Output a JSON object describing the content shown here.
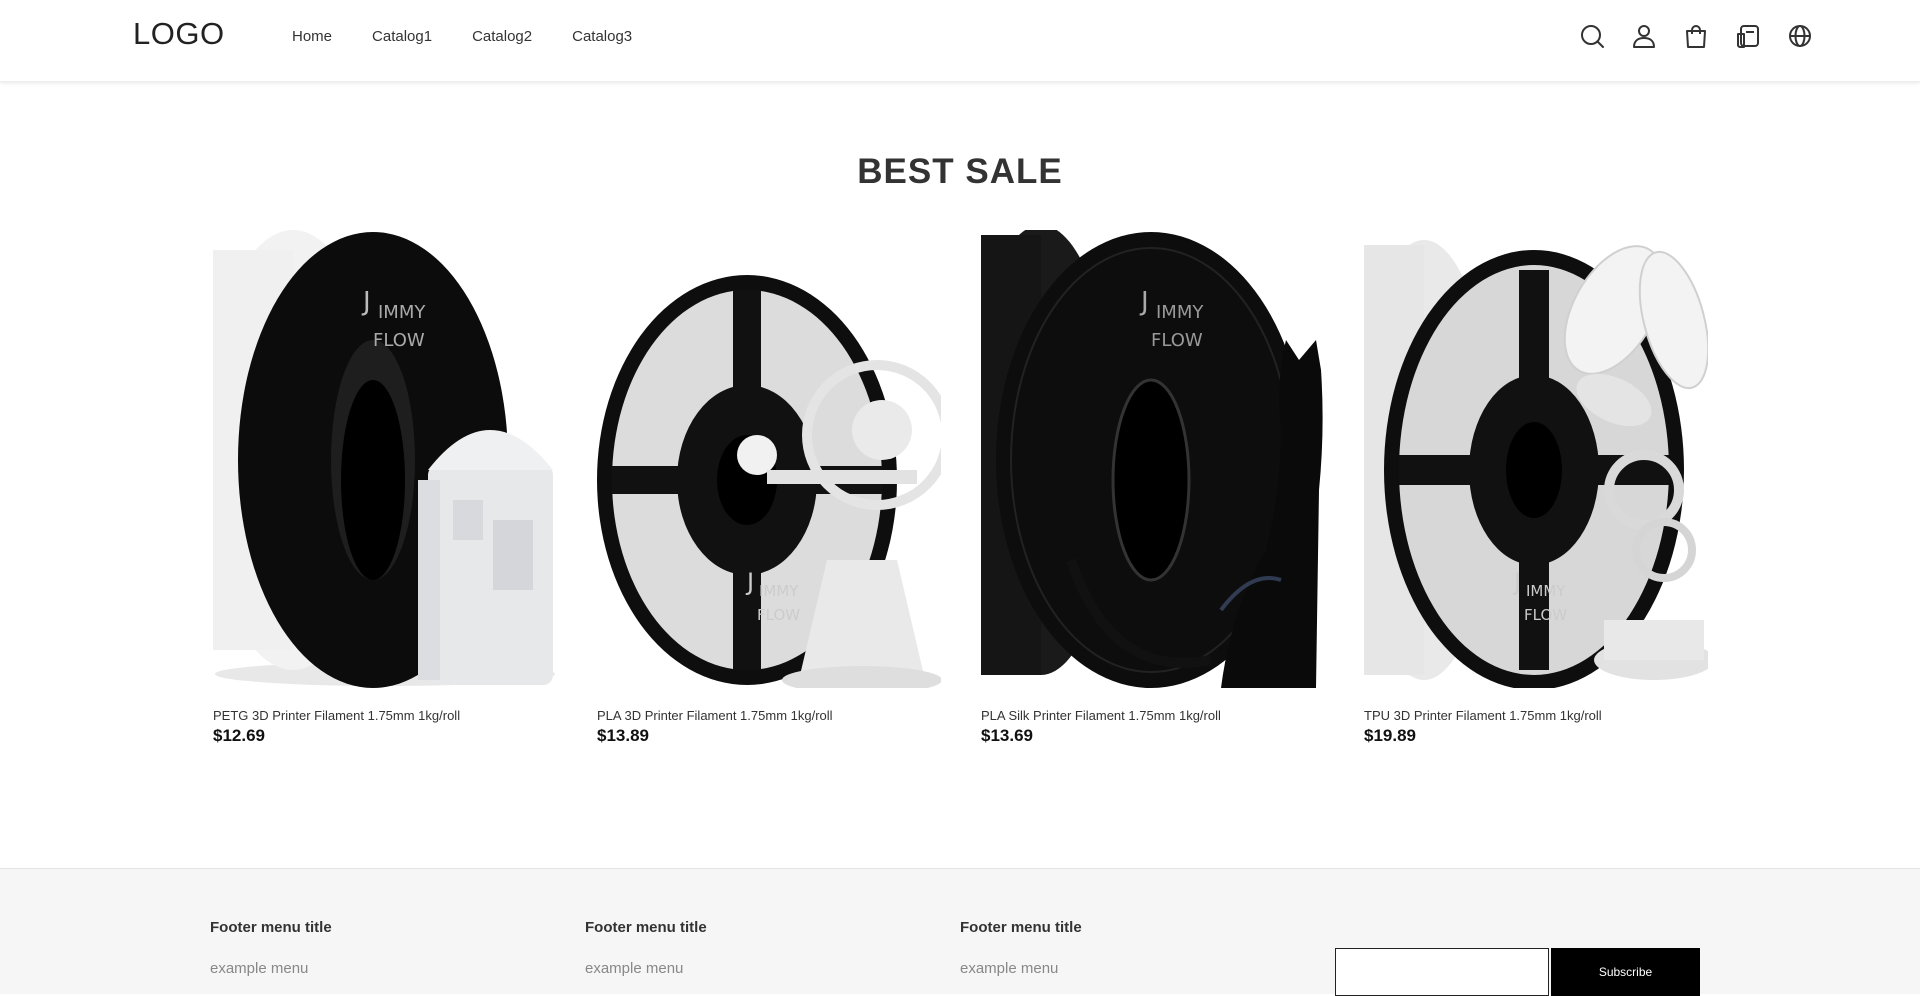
{
  "header": {
    "logo": "LOGO",
    "nav": [
      "Home",
      "Catalog1",
      "Catalog2",
      "Catalog3"
    ],
    "icons": [
      "search-icon",
      "user-icon",
      "cart-icon",
      "order-icon",
      "globe-icon"
    ]
  },
  "section": {
    "title": "BEST SALE",
    "products": [
      {
        "name": "PETG 3D Printer Filament 1.75mm 1kg/roll",
        "price": "$12.69",
        "brand": "JIMMY FLOW",
        "spool_color": "#f2f2f2",
        "model": "robot"
      },
      {
        "name": "PLA 3D Printer Filament 1.75mm 1kg/roll",
        "price": "$13.89",
        "brand": "JIMMY FLOW",
        "spool_color": "#eeeeee",
        "model": "orrery"
      },
      {
        "name": "PLA Silk Printer Filament 1.75mm 1kg/roll",
        "price": "$13.69",
        "brand": "JIMMY FLOW",
        "spool_color": "#111111",
        "model": "cat"
      },
      {
        "name": "TPU 3D Printer Filament 1.75mm 1kg/roll",
        "price": "$19.89",
        "brand": "JIMMY FLOW",
        "spool_color": "#e8e8e8",
        "model": "bee"
      }
    ]
  },
  "footer": {
    "columns": [
      {
        "title": "Footer menu title",
        "link": "example menu"
      },
      {
        "title": "Footer menu title",
        "link": "example menu"
      },
      {
        "title": "Footer menu title",
        "link": "example menu"
      }
    ],
    "subscribe_label": "Subscribe",
    "email_placeholder": ""
  }
}
